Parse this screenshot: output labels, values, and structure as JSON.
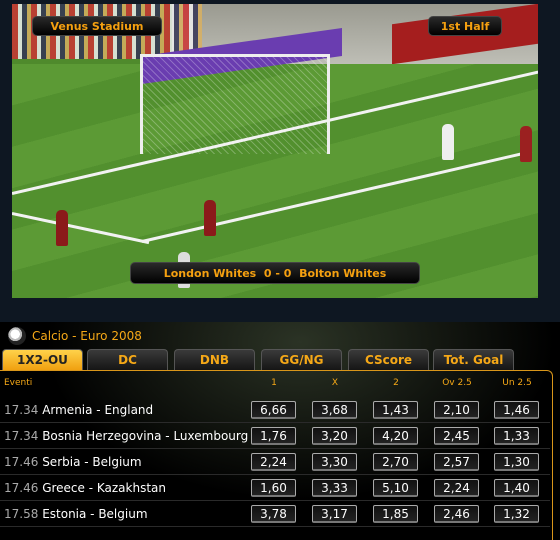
{
  "video": {
    "stadium": "Venus Stadium",
    "period": "1st Half",
    "score": "London Whites  0 - 0  Bolton Whites"
  },
  "section": {
    "icon": "soccer-ball-icon",
    "title": "Calcio - Euro 2008"
  },
  "tabs": [
    {
      "label": "1X2-OU",
      "active": true
    },
    {
      "label": "DC"
    },
    {
      "label": "DNB"
    },
    {
      "label": "GG/NG"
    },
    {
      "label": "CScore"
    },
    {
      "label": "Tot. Goal"
    }
  ],
  "table": {
    "headers": {
      "event": "Eventi",
      "cols": [
        "1",
        "X",
        "2",
        "Ov 2.5",
        "Un 2.5"
      ]
    },
    "rows": [
      {
        "time": "17.34",
        "match": "Armenia - England",
        "odds": [
          "6,66",
          "3,68",
          "1,43",
          "2,10",
          "1,46"
        ]
      },
      {
        "time": "17.34",
        "match": "Bosnia Herzegovina - Luxembourg",
        "odds": [
          "1,76",
          "3,20",
          "4,20",
          "2,45",
          "1,33"
        ]
      },
      {
        "time": "17.46",
        "match": "Serbia - Belgium",
        "odds": [
          "2,24",
          "3,30",
          "2,70",
          "2,57",
          "1,30"
        ]
      },
      {
        "time": "17.46",
        "match": "Greece - Kazakhstan",
        "odds": [
          "1,60",
          "3,33",
          "5,10",
          "2,24",
          "1,40"
        ]
      },
      {
        "time": "17.58",
        "match": "Estonia - Belgium",
        "odds": [
          "3,78",
          "3,17",
          "1,85",
          "2,46",
          "1,32"
        ]
      }
    ]
  },
  "colors": {
    "accent": "#f5a817",
    "active_tab": "#ffc830"
  }
}
